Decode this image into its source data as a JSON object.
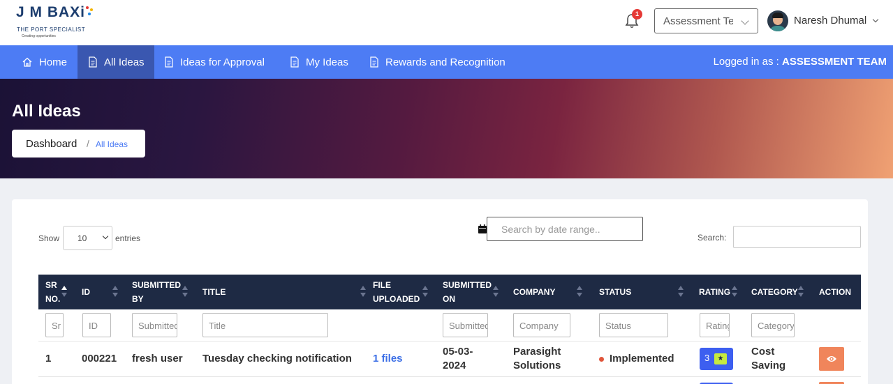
{
  "logo": {
    "brand": "J M BAXi",
    "tagline": "THE PORT SPECIALIST",
    "subline": "Creating opportunities"
  },
  "header": {
    "notification_count": "1",
    "role_select": "Assessment Team",
    "user_name": "Naresh Dhumal"
  },
  "nav": {
    "items": [
      {
        "label": "Home",
        "icon": "home-icon"
      },
      {
        "label": "All Ideas",
        "icon": "document-icon",
        "active": true
      },
      {
        "label": "Ideas for Approval",
        "icon": "document-icon"
      },
      {
        "label": "My Ideas",
        "icon": "document-icon"
      },
      {
        "label": "Rewards and Recognition",
        "icon": "document-icon"
      }
    ],
    "logged_prefix": "Logged in as : ",
    "logged_role": "ASSESSMENT TEAM"
  },
  "hero": {
    "title": "All Ideas",
    "breadcrumb": {
      "root": "Dashboard",
      "separator": "/",
      "current": "All Ideas"
    }
  },
  "controls": {
    "show_label": "Show",
    "entries_value": "10",
    "entries_label": "entries",
    "date_placeholder": "Search by date range..",
    "search_label": "Search:"
  },
  "table": {
    "headers": {
      "sr_line1": "SR",
      "sr_line2": "NO.",
      "id": "ID",
      "submitted_by_line1": "SUBMITTED",
      "submitted_by_line2": "BY",
      "title": "TITLE",
      "file_line1": "FILE",
      "file_line2": "UPLOADED",
      "submitted_on_line1": "SUBMITTED",
      "submitted_on_line2": "ON",
      "company": "COMPANY",
      "status": "STATUS",
      "rating": "RATING",
      "category": "CATEGORY",
      "action": "ACTION"
    },
    "filters": {
      "sr": "Sr",
      "id": "ID",
      "submitted_by": "Submitted By",
      "title": "Title",
      "submitted_on": "Submitted On",
      "company": "Company",
      "status": "Status",
      "rating": "Rating",
      "category": "Category"
    },
    "rows": [
      {
        "sr": "1",
        "id": "000221",
        "submitted_by": "fresh user",
        "title": "Tuesday checking notification",
        "files": "1 files",
        "submitted_on_line1": "05-03-",
        "submitted_on_line2": "2024",
        "company_line1": "Parasight",
        "company_line2": "Solutions",
        "status": "Implemented",
        "status_color": "#e0553b",
        "rating": "3",
        "rating_icon": "star-icon",
        "category_line1": "Cost",
        "category_line2": "Saving",
        "action_icon": "eye-icon"
      }
    ]
  },
  "colors": {
    "nav_bg": "#4d7cf4",
    "nav_active": "#3a57b0",
    "table_header": "#1e2a44",
    "rating_bg": "#3d5ff0",
    "action_bg": "#f0855b",
    "link": "#3c6fe6"
  }
}
